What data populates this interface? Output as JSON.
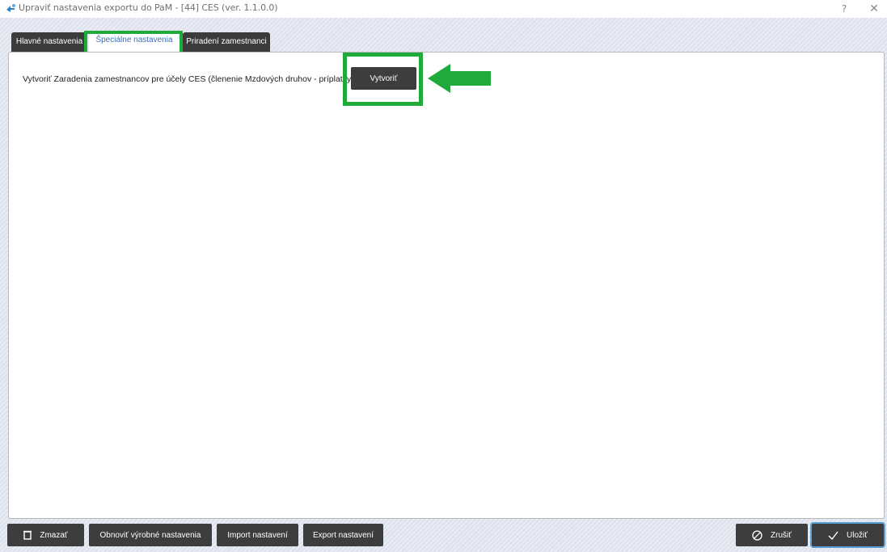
{
  "window": {
    "title": "Upraviť nastavenia exportu do PaM - [44] CES (ver. 1.1.0.0)",
    "help_label": "?",
    "close_label": "✕"
  },
  "tabs": [
    {
      "label": "Hlavné nastavenia",
      "active": false
    },
    {
      "label": "Špeciálne nastavenia",
      "active": true
    },
    {
      "label": "Priradení zamestnanci",
      "active": false
    }
  ],
  "special": {
    "row_label": "Vytvoriť Zaradenia zamestnancov pre účely CES (členenie Mzdových druhov - príplatky)",
    "create_button": "Vytvoriť"
  },
  "footer": {
    "delete_label": "Zmazať",
    "reset_label": "Obnoviť výrobné nastavenia",
    "import_label": "Import nastavení",
    "export_label": "Export nastavení",
    "cancel_label": "Zrušiť",
    "save_label": "Uložiť"
  },
  "colors": {
    "highlight": "#1faa3b",
    "button_bg": "#3d3d3d",
    "active_tab_text": "#3a6fb2"
  },
  "icons": {
    "app": "export-app-icon",
    "delete": "trash-icon",
    "cancel": "cancel-circle-icon",
    "save": "checkmark-icon",
    "annotation": "green-arrow-left-icon"
  }
}
